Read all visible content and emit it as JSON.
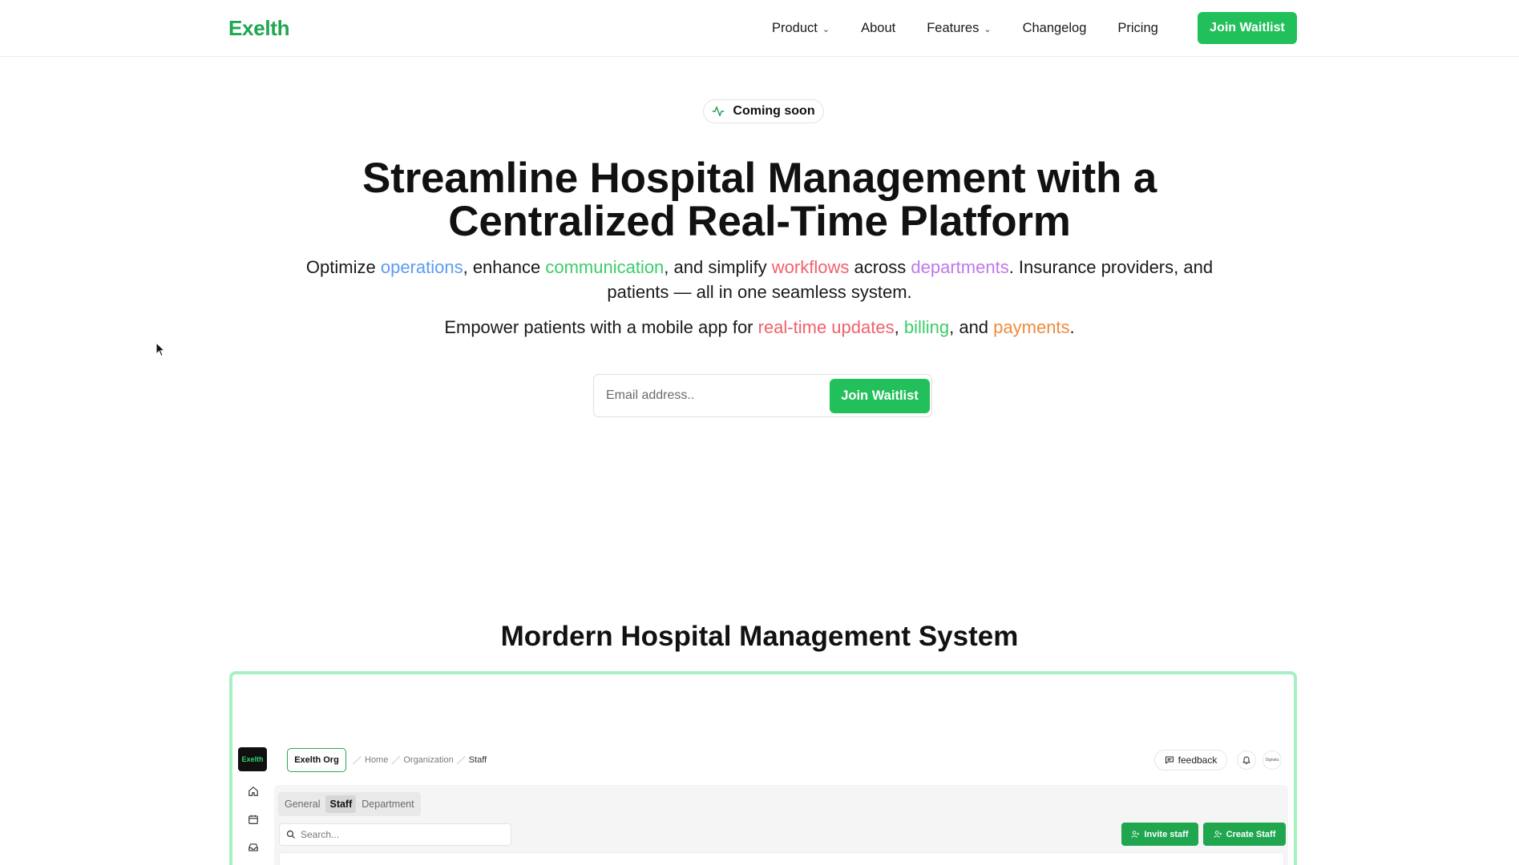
{
  "brand": {
    "name": "Exelth",
    "color": "#1fa64f",
    "accent": "#22c05a"
  },
  "nav": {
    "items": [
      {
        "label": "Product",
        "has_dropdown": true
      },
      {
        "label": "About",
        "has_dropdown": false
      },
      {
        "label": "Features",
        "has_dropdown": true
      },
      {
        "label": "Changelog",
        "has_dropdown": false
      },
      {
        "label": "Pricing",
        "has_dropdown": false
      }
    ],
    "cta_label": "Join Waitlist"
  },
  "hero": {
    "badge": {
      "label": "Coming soon",
      "icon": "activity-pulse-icon"
    },
    "title_line1": "Streamline Hospital Management with a",
    "title_line2": "Centralized Real-Time Platform",
    "subtitle": {
      "t1": "Optimize ",
      "k1": "operations",
      "t2": ", enhance ",
      "k2": "communication",
      "t3": ", and simplify ",
      "k3": "workflows",
      "t4": " across ",
      "k4": "departments",
      "t5": ". Insurance providers, and patients — all in one seamless system."
    },
    "subtitle2": {
      "t1": "Empower patients with a mobile app for ",
      "k1": "real-time updates",
      "t2": ", ",
      "k2": "billing",
      "t3": ", and ",
      "k3": "payments",
      "t4": "."
    },
    "form": {
      "email_placeholder": "Email address..",
      "email_value": "",
      "submit_label": "Join Waitlist"
    },
    "keyword_colors": {
      "blue": "#5b9cf0",
      "green": "#3ccc6a",
      "red": "#f0616c",
      "purple": "#c078ea",
      "orange": "#f08a3c"
    }
  },
  "section": {
    "title": "Mordern Hospital Management System"
  },
  "preview": {
    "app_logo": "Exelth",
    "sidebar_icons": [
      "home-icon",
      "calendar-icon",
      "inbox-icon"
    ],
    "org_label": "Exelth Org",
    "breadcrumb": [
      "Home",
      "Organization",
      "Staff"
    ],
    "feedback_label": "feedback",
    "avatar_label": "Signatu",
    "tabs": [
      {
        "label": "General",
        "active": false
      },
      {
        "label": "Staff",
        "active": true
      },
      {
        "label": "Department",
        "active": false
      }
    ],
    "search_placeholder": "Search...",
    "invite_label": "Invite staff",
    "create_label": "Create Staff"
  }
}
